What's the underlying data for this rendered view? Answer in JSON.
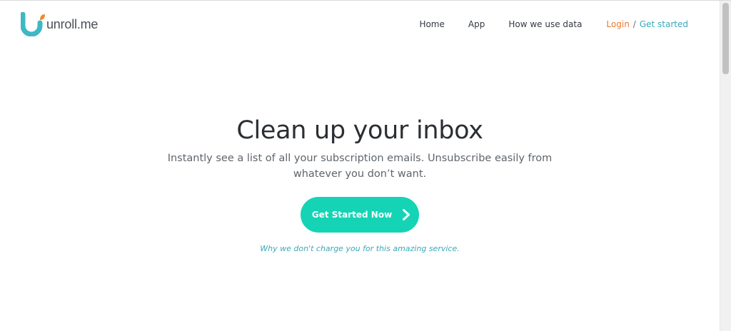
{
  "header": {
    "logo": {
      "text": "unroll.me",
      "mark_icon": "unroll-u-logo-icon",
      "colors": {
        "teal": "#3db8c4",
        "orange": "#f08a24"
      }
    },
    "nav": {
      "home": "Home",
      "app": "App",
      "how_we_use_data": "How we use data",
      "login": "Login",
      "separator": "/",
      "get_started": "Get started"
    }
  },
  "hero": {
    "title": "Clean up your inbox",
    "subtitle": "Instantly see a list of all your subscription emails. Unsubscribe easily from whatever you don’t want.",
    "cta": {
      "label": "Get Started Now",
      "icon": "chevron-right-icon",
      "color": "#14d4b5"
    },
    "why_link": "Why we don't charge you for this amazing service."
  },
  "colors": {
    "accent_teal": "#3aa9b8",
    "login_orange": "#e8792d",
    "cta_green": "#14d4b5",
    "text_dark": "#2b2f33"
  }
}
